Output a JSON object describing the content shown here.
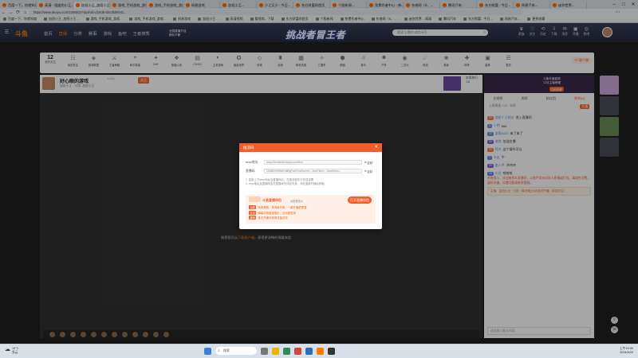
{
  "browser": {
    "tabs": [
      "百度一下，你就知道",
      "高清 · 姐姐的小王...",
      "加班小王_加班小王...",
      "游戏_手机游戏_游戏...",
      "游戏_手机游戏_游戏...",
      "网易游戏",
      "加班小王...",
      "少之又少 - 今日...",
      "东方财富网首页",
      "个股新闻...",
      "免费作者中心 - 神...",
      "东南网（S、...",
      "腾讯汽车",
      "东方财富 - 今日...",
      "网易汽车...",
      "迷你世界..."
    ],
    "url": "https://www.douyu.com/1006810?dyshid=d18d5-5bcd508041...",
    "bookmarks": [
      "百度一下，你就知道",
      "加班小王_加班小王...",
      "游戏_手机游戏_游戏...",
      "游戏_手机游戏_游戏...",
      "网易游戏",
      "加班小王...",
      "高清视频",
      "看视频，下载",
      "东方财富网首页",
      "个股新闻",
      "免费作者中心",
      "东南网（S、...",
      "迷你世界... 高清",
      "腾讯汽车",
      "东方财富 - 今日...",
      "网易汽车...",
      "更多收藏"
    ]
  },
  "header": {
    "logo": "斗鱼",
    "nav": [
      "首页",
      "直播",
      "分类",
      "赛事",
      "游戏",
      "鱼吧",
      "王者搜秀"
    ],
    "nav_active": "直播",
    "promo_line1": "全国直播节目",
    "promo_line2": "精彩不断",
    "banner_title": "挑战者冒王者",
    "search_placeholder": "搜索主播名或房间号",
    "icons": [
      {
        "glyph": "♛",
        "label": "贵族"
      },
      {
        "glyph": "♡",
        "label": "关注"
      },
      {
        "glyph": "⟲",
        "label": "历史"
      },
      {
        "glyph": "⇩",
        "label": "下载"
      },
      {
        "glyph": "✉",
        "label": "消息"
      },
      {
        "glyph": "▣",
        "label": "开播"
      },
      {
        "glyph": "◎",
        "label": "鱼吧"
      }
    ]
  },
  "category_bar": {
    "follow_count": "12",
    "follow_label": "我的关注",
    "items": [
      {
        "glyph": "☷",
        "label": "我的关注"
      },
      {
        "glyph": "◈",
        "label": "英雄联盟"
      },
      {
        "glyph": "⚔",
        "label": "王者荣耀"
      },
      {
        "glyph": "⌖",
        "label": "和平精英"
      },
      {
        "glyph": "✦",
        "label": "DNF"
      },
      {
        "glyph": "❖",
        "label": "穿越火线"
      },
      {
        "glyph": "▤",
        "label": "CS:GO"
      },
      {
        "glyph": "◐",
        "label": "主机游戏"
      },
      {
        "glyph": "✪",
        "label": "魔兽世界"
      },
      {
        "glyph": "◇",
        "label": "传奇"
      },
      {
        "glyph": "♜",
        "label": "全部"
      },
      {
        "glyph": "▦",
        "label": "单机热游"
      },
      {
        "glyph": "✧",
        "label": "三国杀"
      },
      {
        "glyph": "⬢",
        "label": "颜值"
      },
      {
        "glyph": "♫",
        "label": "音乐"
      },
      {
        "glyph": "☻",
        "label": "户外"
      },
      {
        "glyph": "◉",
        "label": "二次元"
      },
      {
        "glyph": "☄",
        "label": "科技"
      },
      {
        "glyph": "❀",
        "label": "美食"
      },
      {
        "glyph": "✚",
        "label": "体育"
      },
      {
        "glyph": "▣",
        "label": "星秀"
      },
      {
        "glyph": "☰",
        "label": "更多"
      }
    ],
    "pc_button": "PC客户端"
  },
  "streamer": {
    "name": "好心眼的游戏",
    "badge": "LV32 ·",
    "follow_button": "关注",
    "sub": "加班小王 · 分类: 加班小王",
    "rank_card_line1": "本周排行",
    "rank_card_line2": "1/8"
  },
  "player": {
    "tip_prefix": "推荐您可以",
    "tip_highlight": "下载客户端",
    "tip_suffix": "，获得更流畅的观看体验"
  },
  "right_column": {
    "topcard_line1": "斗鱼年度盛典",
    "topcard_line2": "12月主播荣耀",
    "topcard_button": "立即查看",
    "tabs": [
      "在线榜",
      "周榜",
      "粉丝团",
      "贵宾(N)"
    ],
    "tab_active": "贵宾(N)",
    "rank_hint": "上周周星 LV3 · 本周",
    "rank_pill": "开通",
    "chat": [
      {
        "level": "25",
        "name": "加班小王粉丝",
        "text": "进入直播间",
        "lvl": "o"
      },
      {
        "level": "8",
        "name": "小明",
        "text": "666",
        "lvl": "b"
      },
      {
        "level": "12",
        "name": "游客8823",
        "text": "来了来了",
        "lvl": "b"
      },
      {
        "level": "30",
        "name": "老铁",
        "text": "加油主播",
        "lvl": "p"
      },
      {
        "level": "18",
        "name": "阿杰",
        "text": "这个操作可以",
        "lvl": "o"
      },
      {
        "level": "7",
        "name": "水友",
        "text": "牛",
        "lvl": "b"
      },
      {
        "level": "22",
        "name": "路人甲",
        "text": "冲冲冲",
        "lvl": "p"
      },
      {
        "level": "15",
        "name": "小白",
        "text": "哈哈哈",
        "lvl": "b"
      }
    ],
    "system_message": "系统提示：欢迎来到本直播间，斗鱼严禁未成年人直播或打赏。请理性消费，谨防诈骗，如遇问题请联系客服。",
    "notice": "主播：加班小王 · 公告：每天晚上8点准时开播，欢迎关注！",
    "chat_input_placeholder": "这里输入聊天内容"
  },
  "modal": {
    "title": "推流码",
    "rtmp_label": "rtmp地址:",
    "rtmp_value": "rtmp://sendtc3a.douyu.com/live",
    "key_label": "直播码:",
    "key_value": "1006810rM5iAHaiBgPuwl?wsSecret=...&wsTime=...&wsSeek=...",
    "copy_label": "复制",
    "notes": [
      "1. 复制上方rtmp地址及直播码后，在推流软件中完成设置",
      "2. rtmp地址及直播码会在直播间关闭后失效，请在重新开播后获取"
    ],
    "promo_title": "斗鱼直播伴侣",
    "promo_sub": "功能更强大",
    "promo_button": "打开直播伴侣",
    "promo_items": [
      {
        "tag": "功能",
        "text": "特效美颜、多场景切换，一键开播更便捷"
      },
      {
        "tag": "互动",
        "text": "弹幕礼物直接展示，互动更直观"
      },
      {
        "tag": "推荐",
        "text": "首次开播可获得流量扶持"
      }
    ]
  },
  "taskbar": {
    "temp": "19°C",
    "weather": "多云",
    "search": "搜索",
    "time": "上午10:00",
    "date": "2024/6/20"
  },
  "colors": {
    "accent": "#f25d2a",
    "brand": "#ff7a00",
    "header_bg": "#2c3046"
  }
}
